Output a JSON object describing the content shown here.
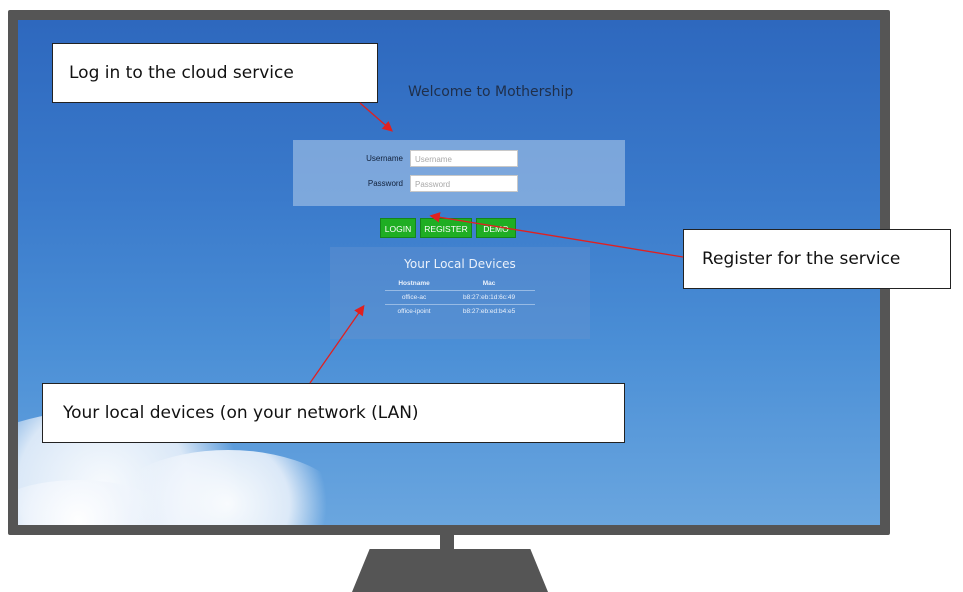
{
  "screen": {
    "title": "Welcome to Mothership"
  },
  "login": {
    "username_label": "Username",
    "username_placeholder": "Username",
    "password_label": "Password",
    "password_placeholder": "Password"
  },
  "buttons": {
    "login": "LOGIN",
    "register": "REGISTER",
    "demo": "DEMO"
  },
  "devices": {
    "title": "Your Local Devices",
    "columns": [
      "Hostname",
      "Mac"
    ],
    "rows": [
      {
        "hostname": "office-ac",
        "mac": "b8:27:eb:1d:6c:49"
      },
      {
        "hostname": "office-ipoint",
        "mac": "b8:27:eb:ed:b4:e5"
      }
    ]
  },
  "annotations": {
    "login": "Log in to the cloud service",
    "register": "Register for the service",
    "devices": "Your local devices (on your network (LAN)"
  },
  "colors": {
    "button_green": "#1fae23",
    "arrow_red": "#e02020",
    "frame_gray": "#555555"
  }
}
